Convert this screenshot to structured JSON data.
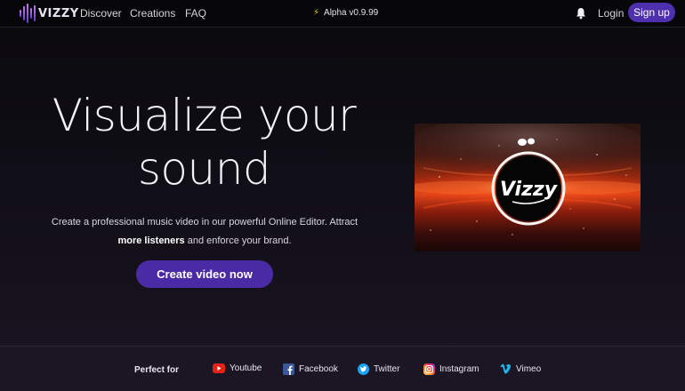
{
  "header": {
    "logo_text": "VIZZY",
    "nav": [
      "Discover",
      "Creations",
      "FAQ"
    ],
    "version": "Alpha v0.9.99",
    "login": "Login",
    "signup": "Sign up"
  },
  "hero": {
    "title_line1": "Visualize your",
    "title_line2": "sound",
    "desc_part1": "Create a professional music video in our powerful Online Editor. Attract ",
    "desc_bold": "more listeners",
    "desc_part2": " and enforce your brand.",
    "cta": "Create video now"
  },
  "preview": {
    "badge_text": "Vizzy"
  },
  "footer": {
    "perfect_for": "Perfect for",
    "platforms": [
      {
        "label": "Youtube",
        "icon": "youtube-icon",
        "color": "#e62117"
      },
      {
        "label": "Facebook",
        "icon": "facebook-icon",
        "color": "#3b5998"
      },
      {
        "label": "Twitter",
        "icon": "twitter-icon",
        "color": "#1da1f2"
      },
      {
        "label": "Instagram",
        "icon": "instagram-icon",
        "color": "#e1306c"
      },
      {
        "label": "Vimeo",
        "icon": "vimeo-icon",
        "color": "#1ab7ea"
      }
    ]
  },
  "colors": {
    "accent": "#4b2aa6",
    "background": "#0b0a0f",
    "footer_bg": "#1b1524"
  }
}
